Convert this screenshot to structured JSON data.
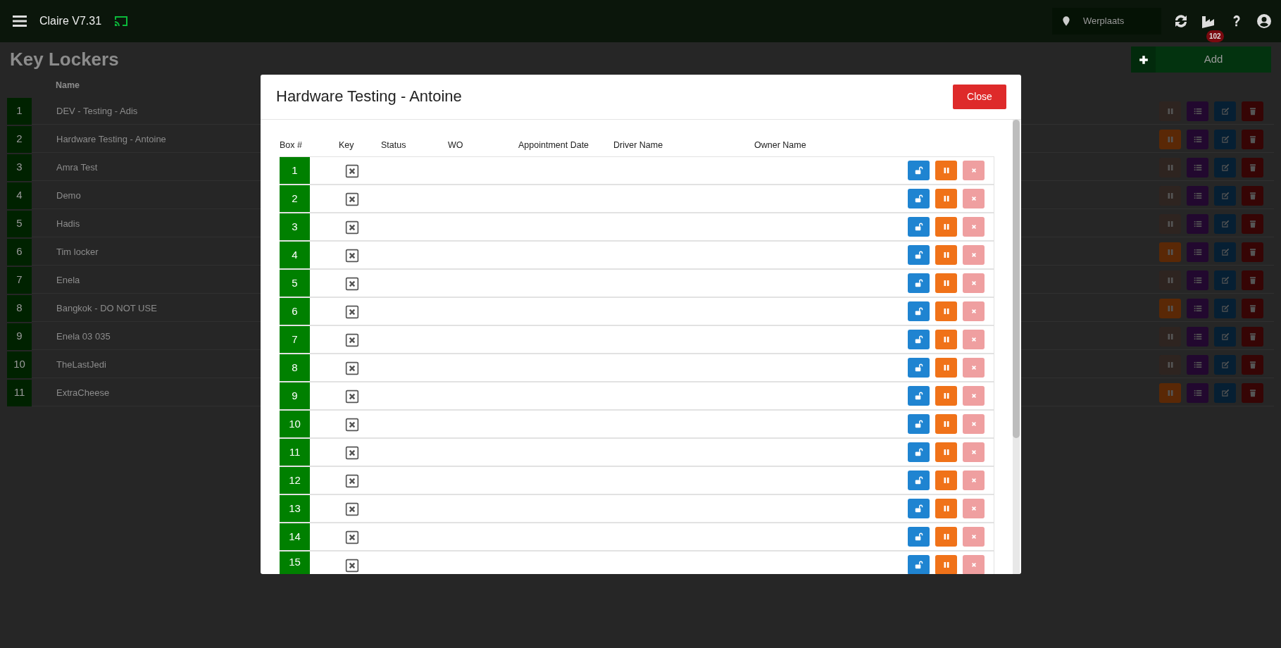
{
  "navbar": {
    "app_title": "Claire V7.31",
    "location": "Werplaats",
    "notification_count": "102"
  },
  "page": {
    "title": "Key Lockers",
    "add_button": "Add"
  },
  "lockers": {
    "columns": [
      "Name"
    ],
    "rows": [
      {
        "number": "1",
        "name": "DEV - Testing - Adis",
        "pause_enabled": false
      },
      {
        "number": "2",
        "name": "Hardware Testing - Antoine",
        "pause_enabled": true
      },
      {
        "number": "3",
        "name": "Amra Test",
        "pause_enabled": false
      },
      {
        "number": "4",
        "name": "Demo",
        "pause_enabled": false
      },
      {
        "number": "5",
        "name": "Hadis",
        "pause_enabled": false
      },
      {
        "number": "6",
        "name": "Tim locker",
        "pause_enabled": true
      },
      {
        "number": "7",
        "name": "Enela",
        "pause_enabled": false
      },
      {
        "number": "8",
        "name": "Bangkok - DO NOT USE",
        "pause_enabled": true
      },
      {
        "number": "9",
        "name": "Enela 03 035",
        "pause_enabled": false
      },
      {
        "number": "10",
        "name": "TheLastJedi",
        "pause_enabled": false
      },
      {
        "number": "11",
        "name": "ExtraCheese",
        "pause_enabled": true
      }
    ]
  },
  "modal": {
    "title": "Hardware Testing - Antoine",
    "close_button": "Close",
    "columns": [
      "Box #",
      "Key",
      "Status",
      "WO",
      "Appointment Date",
      "Driver Name",
      "Owner Name"
    ],
    "boxes": [
      {
        "number": "1",
        "key_present": false,
        "cancel_disabled": true
      },
      {
        "number": "2",
        "key_present": false,
        "cancel_disabled": true
      },
      {
        "number": "3",
        "key_present": false,
        "cancel_disabled": true
      },
      {
        "number": "4",
        "key_present": false,
        "cancel_disabled": true
      },
      {
        "number": "5",
        "key_present": false,
        "cancel_disabled": true
      },
      {
        "number": "6",
        "key_present": false,
        "cancel_disabled": true
      },
      {
        "number": "7",
        "key_present": false,
        "cancel_disabled": true
      },
      {
        "number": "8",
        "key_present": false,
        "cancel_disabled": true
      },
      {
        "number": "9",
        "key_present": false,
        "cancel_disabled": true
      },
      {
        "number": "10",
        "key_present": false,
        "cancel_disabled": true
      },
      {
        "number": "11",
        "key_present": false,
        "cancel_disabled": true
      },
      {
        "number": "12",
        "key_present": false,
        "cancel_disabled": true
      },
      {
        "number": "13",
        "key_present": false,
        "cancel_disabled": true
      },
      {
        "number": "14",
        "key_present": false,
        "cancel_disabled": true
      },
      {
        "number": "15",
        "key_present": false,
        "cancel_disabled": true
      }
    ]
  }
}
